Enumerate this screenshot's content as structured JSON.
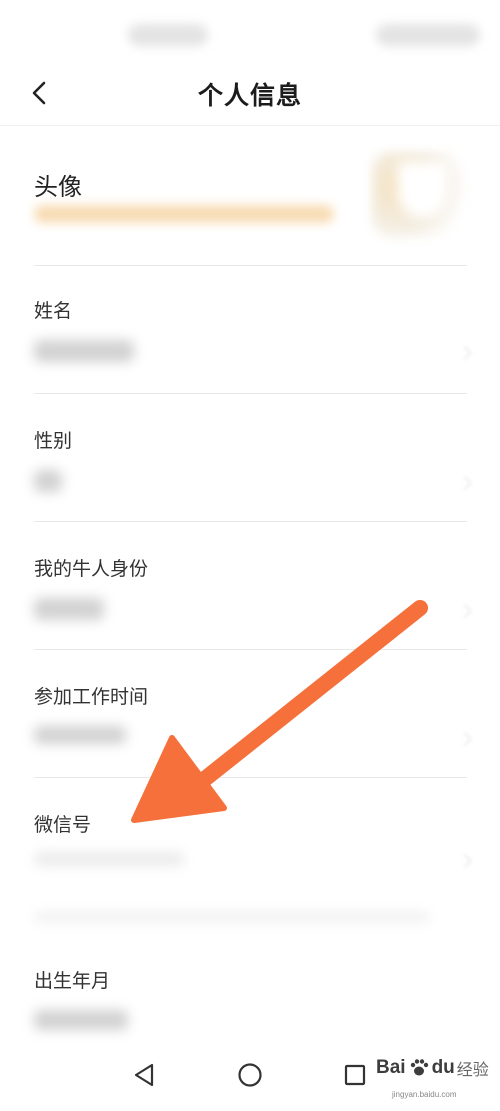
{
  "header": {
    "title": "个人信息"
  },
  "rows": {
    "avatar": {
      "label": "头像"
    },
    "name": {
      "label": "姓名"
    },
    "gender": {
      "label": "性别"
    },
    "identity": {
      "label": "我的牛人身份"
    },
    "work_start": {
      "label": "参加工作时间"
    },
    "wechat": {
      "label": "微信号"
    },
    "birth": {
      "label": "出生年月"
    }
  },
  "watermark": {
    "brand": "Bai",
    "brand_suffix": "du",
    "sub": "经验",
    "url": "jingyan.baidu.com"
  },
  "colors": {
    "arrow": "#f5703a",
    "accent_orange": "#f7d8ac",
    "divider": "#e8e8e8"
  },
  "icons": {
    "back": "chevron-left-icon",
    "sys_back": "triangle-back-icon",
    "sys_home": "circle-home-icon",
    "sys_recent": "square-recent-icon"
  }
}
